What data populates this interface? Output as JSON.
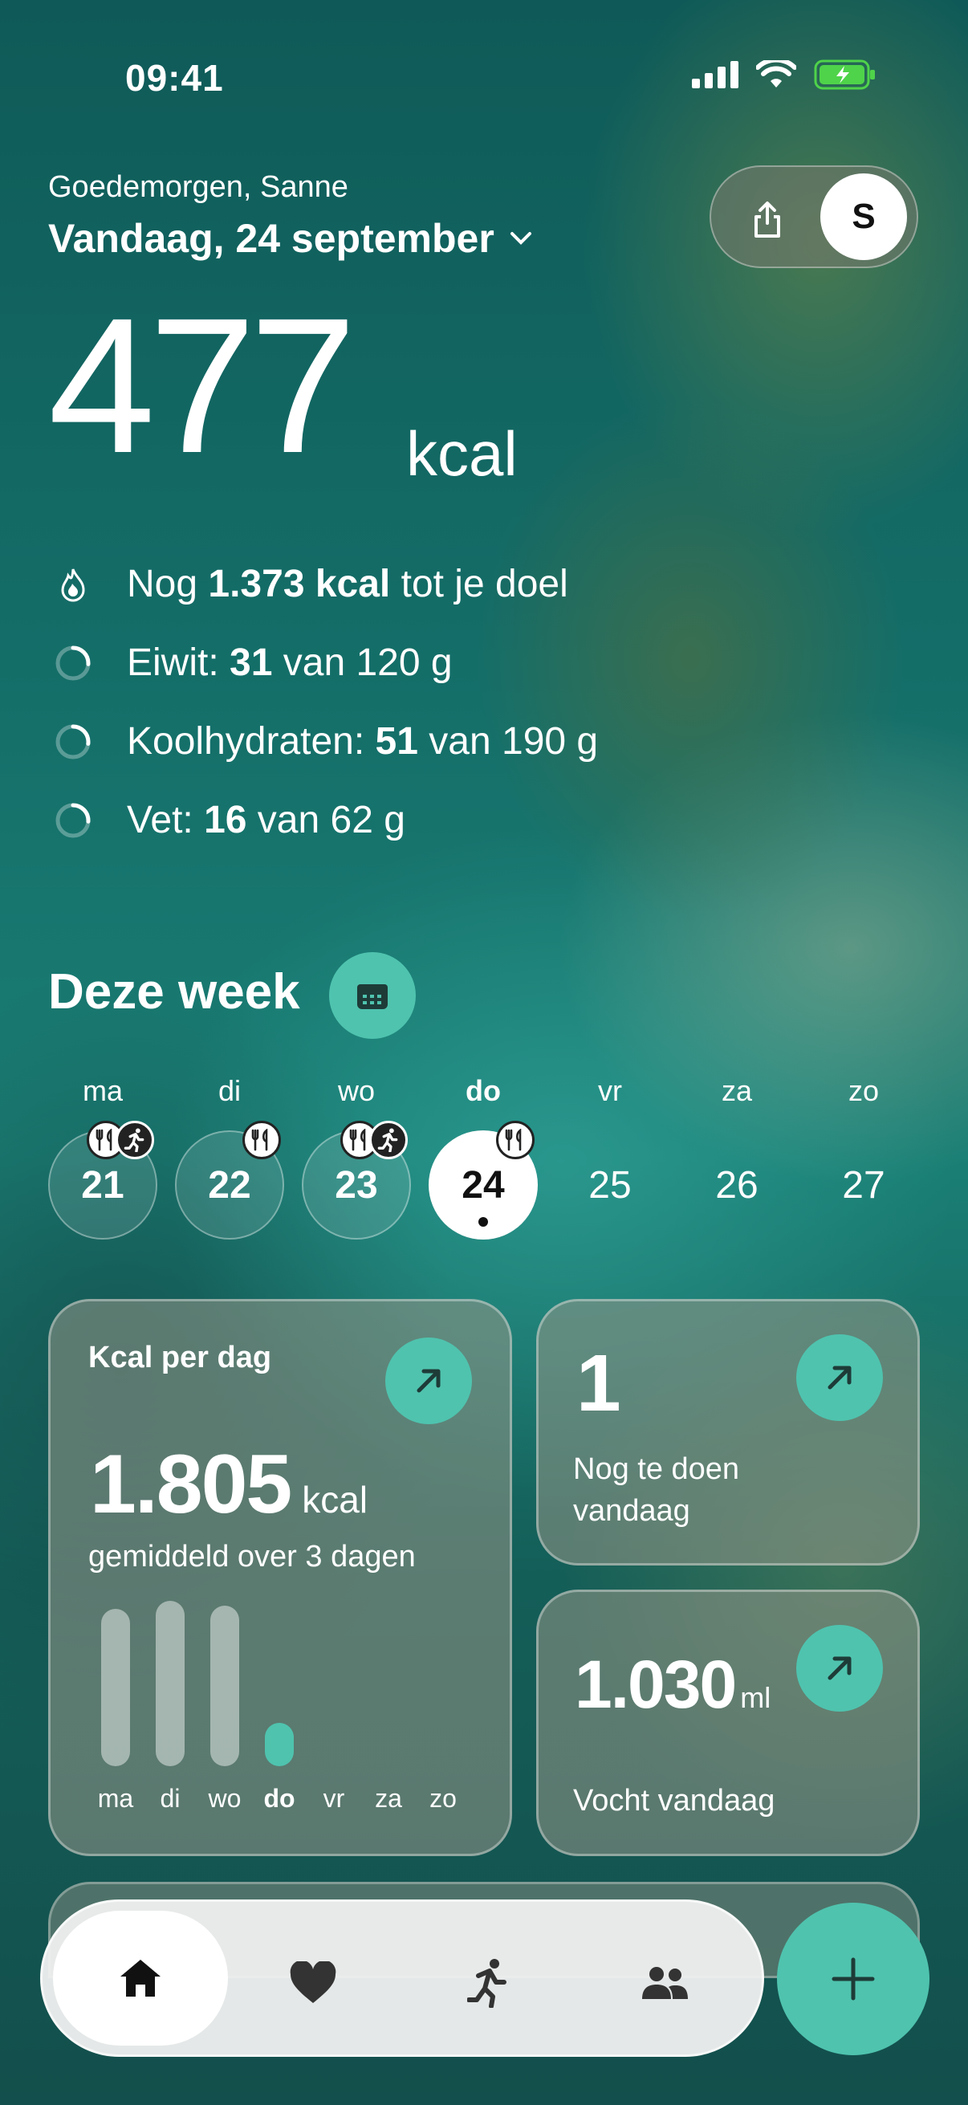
{
  "status": {
    "time": "09:41"
  },
  "header": {
    "greeting": "Goedemorgen, Sanne",
    "date": "Vandaag, 24 september",
    "avatar_initial": "S"
  },
  "calories": {
    "value": "477",
    "unit": "kcal"
  },
  "stats": [
    {
      "pre": "Nog ",
      "bold": "1.373 kcal",
      "post": " tot je doel",
      "icon": "flame-icon"
    },
    {
      "pre": "Eiwit: ",
      "bold": "31",
      "post": " van 120 g",
      "icon": "progress-ring-icon",
      "progress": 0.26
    },
    {
      "pre": "Koolhydraten: ",
      "bold": "51",
      "post": " van 190 g",
      "icon": "progress-ring-icon",
      "progress": 0.27
    },
    {
      "pre": "Vet: ",
      "bold": "16",
      "post": " van 62 g",
      "icon": "progress-ring-icon",
      "progress": 0.26
    }
  ],
  "week": {
    "title": "Deze week",
    "days": [
      {
        "label": "ma",
        "num": "21",
        "state": "past",
        "badges": [
          "food-icon",
          "run-icon"
        ]
      },
      {
        "label": "di",
        "num": "22",
        "state": "past",
        "badges": [
          "food-icon"
        ]
      },
      {
        "label": "wo",
        "num": "23",
        "state": "past",
        "badges": [
          "food-icon",
          "run-icon"
        ]
      },
      {
        "label": "do",
        "num": "24",
        "state": "today",
        "badges": [
          "food-icon"
        ]
      },
      {
        "label": "vr",
        "num": "25",
        "state": "future",
        "badges": []
      },
      {
        "label": "za",
        "num": "26",
        "state": "future",
        "badges": []
      },
      {
        "label": "zo",
        "num": "27",
        "state": "future",
        "badges": []
      }
    ]
  },
  "kcal_card": {
    "title": "Kcal per dag",
    "value": "1.805",
    "unit": "kcal",
    "subtitle": "gemiddeld over 3 dagen",
    "bars": [
      {
        "label": "ma",
        "level": 0.95
      },
      {
        "label": "di",
        "level": 1.0
      },
      {
        "label": "wo",
        "level": 0.97
      },
      {
        "label": "do",
        "level": 0.26
      },
      {
        "label": "vr",
        "level": 0
      },
      {
        "label": "za",
        "level": 0
      },
      {
        "label": "zo",
        "level": 0
      }
    ]
  },
  "todo_card": {
    "value": "1",
    "label": "Nog te doen vandaag"
  },
  "fluid_card": {
    "value": "1.030",
    "unit": "ml",
    "label": "Vocht vandaag"
  },
  "colors": {
    "accent": "#4fc3ae"
  },
  "nav": [
    "home-icon",
    "heart-icon",
    "run-icon",
    "people-icon"
  ]
}
